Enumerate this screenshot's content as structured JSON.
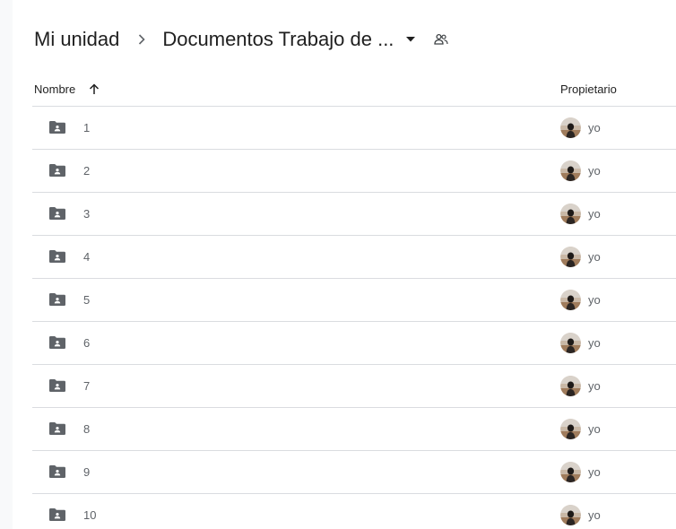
{
  "breadcrumb": {
    "root": "Mi unidad",
    "current": "Documentos Trabajo de ..."
  },
  "table": {
    "header_name": "Nombre",
    "header_owner": "Propietario",
    "rows": [
      {
        "name": "1",
        "owner": "yo"
      },
      {
        "name": "2",
        "owner": "yo"
      },
      {
        "name": "3",
        "owner": "yo"
      },
      {
        "name": "4",
        "owner": "yo"
      },
      {
        "name": "5",
        "owner": "yo"
      },
      {
        "name": "6",
        "owner": "yo"
      },
      {
        "name": "7",
        "owner": "yo"
      },
      {
        "name": "8",
        "owner": "yo"
      },
      {
        "name": "9",
        "owner": "yo"
      },
      {
        "name": "10",
        "owner": "yo"
      }
    ]
  },
  "icons": {
    "folder": "shared-folder-icon",
    "sort": "arrow-up-icon",
    "dropdown": "caret-down-icon",
    "shared": "people-icon",
    "separator": "chevron-right-icon"
  },
  "colors": {
    "folder": "#5f6368",
    "divider": "#dadce0",
    "text_primary": "#1f1f1f",
    "text_secondary": "#5f6368"
  }
}
